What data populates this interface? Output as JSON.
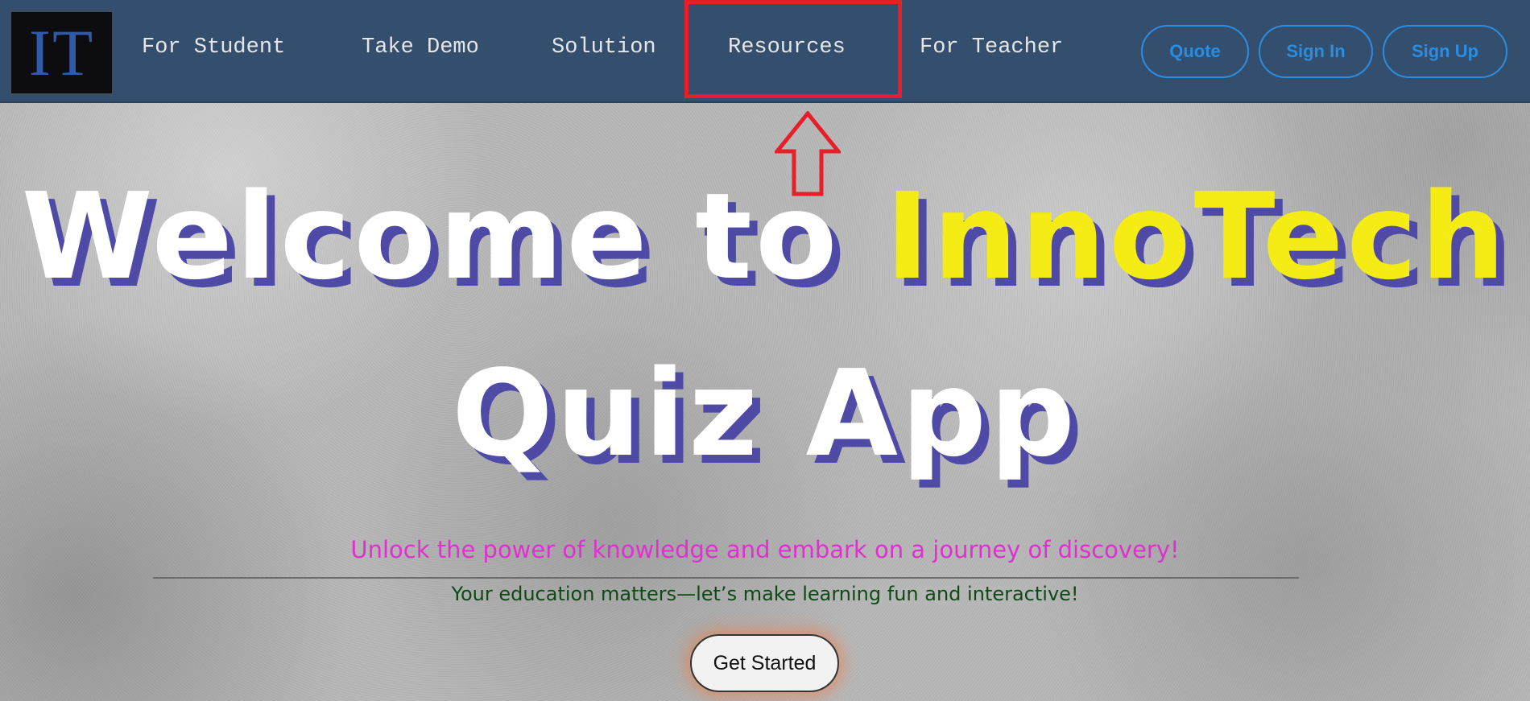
{
  "header": {
    "logo_text": "IT",
    "nav": [
      {
        "label": "For Student"
      },
      {
        "label": "Take Demo"
      },
      {
        "label": "Solution"
      },
      {
        "label": "Resources"
      },
      {
        "label": "For Teacher"
      }
    ],
    "buttons": {
      "quote": "Quote",
      "sign_in": "Sign In",
      "sign_up": "Sign Up"
    },
    "highlighted_item": "Resources"
  },
  "hero": {
    "line1_prefix": "Welcome to",
    "line1_accent": "InnoTech",
    "line2": "Quiz App",
    "tagline": "Unlock the power of knowledge and embark on a journey of discovery!",
    "subline": "Your education matters—let’s make learning fun and interactive!",
    "cta_label": "Get Started"
  },
  "colors": {
    "navbar_bg": "#344e6e",
    "accent_blue": "#2b8de0",
    "annotation_red": "#e52029",
    "hero_accent_yellow": "#f4ec14",
    "hero_shadow": "#4e4aa6",
    "tagline_magenta": "#e030cf",
    "subline_green": "#0f4a16"
  },
  "icons": {
    "annotation": "up-arrow-icon"
  }
}
